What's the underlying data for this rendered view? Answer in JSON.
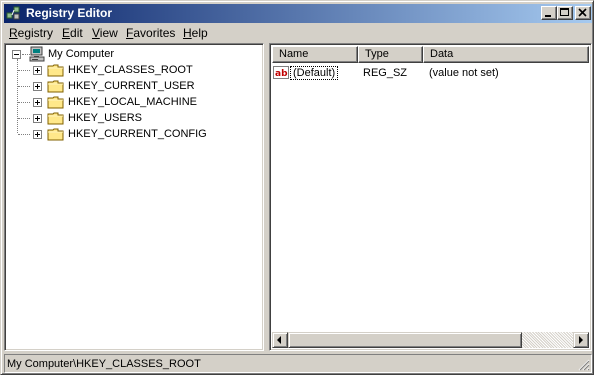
{
  "window": {
    "title": "Registry Editor",
    "title_bar_color": "#0a246a"
  },
  "title_buttons": [
    "minimize-icon",
    "maximize-icon",
    "close-icon"
  ],
  "menu": [
    {
      "label": "Registry",
      "accel": "R",
      "rest": "egistry"
    },
    {
      "label": "Edit",
      "accel": "E",
      "rest": "dit"
    },
    {
      "label": "View",
      "accel": "V",
      "rest": "iew"
    },
    {
      "label": "Favorites",
      "accel": "F",
      "rest": "avorites"
    },
    {
      "label": "Help",
      "accel": "H",
      "rest": "elp"
    }
  ],
  "tree": {
    "root": {
      "label": "My Computer",
      "icon": "computer-icon",
      "expanded": true
    },
    "children": [
      {
        "label": "HKEY_CLASSES_ROOT",
        "icon": "folder-icon",
        "expanded": false
      },
      {
        "label": "HKEY_CURRENT_USER",
        "icon": "folder-icon",
        "expanded": false
      },
      {
        "label": "HKEY_LOCAL_MACHINE",
        "icon": "folder-icon",
        "expanded": false
      },
      {
        "label": "HKEY_USERS",
        "icon": "folder-icon",
        "expanded": false
      },
      {
        "label": "HKEY_CURRENT_CONFIG",
        "icon": "folder-icon",
        "expanded": false
      }
    ]
  },
  "list": {
    "columns": [
      "Name",
      "Type",
      "Data"
    ],
    "rows": [
      {
        "name": "(Default)",
        "type": "REG_SZ",
        "data": "(value not set)",
        "icon": "string-value-icon"
      }
    ]
  },
  "status": {
    "path": "My Computer\\HKEY_CLASSES_ROOT"
  }
}
